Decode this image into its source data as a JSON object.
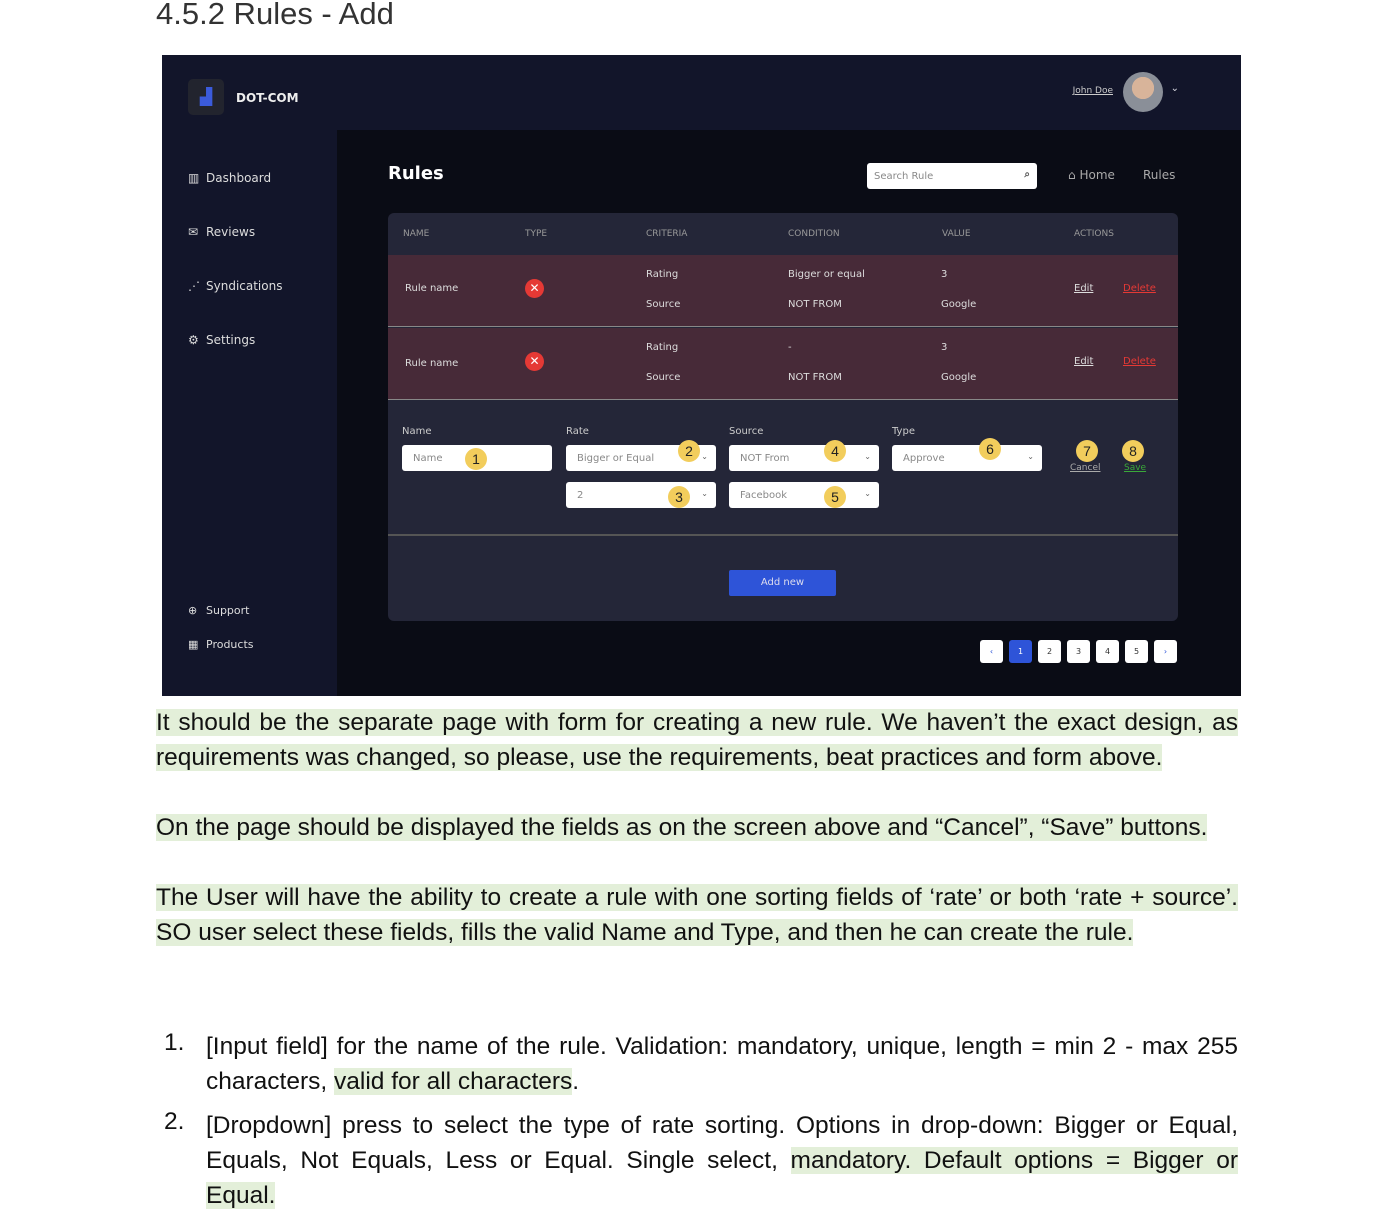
{
  "heading": "4.5.2 Rules - Add",
  "app": {
    "brand": "DOT-COM",
    "nav": [
      "Dashboard",
      "Reviews",
      "Syndications",
      "Settings"
    ],
    "nav_bottom": [
      "Support",
      "Products"
    ],
    "user": "John Doe",
    "page_title": "Rules",
    "search_placeholder": "Search Rule",
    "breadcrumb": [
      "Home",
      "Rules"
    ],
    "columns": [
      "NAME",
      "TYPE",
      "CRITERIA",
      "CONDITION",
      "VALUE",
      "ACTIONS"
    ],
    "rows": [
      {
        "name": "Rule name",
        "criteria": [
          "Rating",
          "Source"
        ],
        "condition": [
          "Bigger or equal",
          "NOT FROM"
        ],
        "value": [
          "3",
          "Google"
        ],
        "edit": "Edit",
        "delete": "Delete"
      },
      {
        "name": "Rule name",
        "criteria": [
          "Rating",
          "Source"
        ],
        "condition": [
          "-",
          "NOT FROM"
        ],
        "value": [
          "3",
          "Google"
        ],
        "edit": "Edit",
        "delete": "Delete"
      }
    ],
    "form": {
      "labels": {
        "name": "Name",
        "rate": "Rate",
        "source": "Source",
        "type": "Type"
      },
      "name_placeholder": "Name",
      "rate": "Bigger or Equal",
      "rate_value": "2",
      "source": "NOT From",
      "source_value": "Facebook",
      "type": "Approve",
      "cancel": "Cancel",
      "save": "Save",
      "badges": [
        "1",
        "2",
        "3",
        "4",
        "5",
        "6",
        "7",
        "8"
      ]
    },
    "add_new": "Add new",
    "pages": [
      "1",
      "2",
      "3",
      "4",
      "5"
    ],
    "current_page": 1,
    "colors": {
      "accent": "#2e54d8",
      "row": "#472a38",
      "delete": "#e53935",
      "save": "#3aa83a",
      "badge": "#f2cd5c"
    }
  },
  "paragraphs": [
    "It should be the separate page with form for creating a new rule. We haven’t the exact design, as requirements was changed, so please, use the requirements, beat practices and form above.",
    "On the page should be displayed the fields as on the screen above and “Cancel”, “Save” buttons.",
    "The User will have the ability to create a rule with  one sorting fields of ‘rate’ or both ‘rate + source’. SO user select these fields, fills the valid Name and Type, and then he can create the rule."
  ],
  "list": [
    {
      "n": "1.",
      "text": "[Input field] for the name of the rule. Validation: mandatory, unique, length = min 2 - max 255 characters, ",
      "hl": "valid for all characters",
      "end": "."
    },
    {
      "n": "2.",
      "text": "[Dropdown] press to select the type of rate sorting. Options in drop-down: Bigger or Equal, Equals, Not Equals, Less or Equal. Single select, ",
      "hl": "mandatory. Default options = Bigger or Equal.",
      "end": ""
    }
  ]
}
